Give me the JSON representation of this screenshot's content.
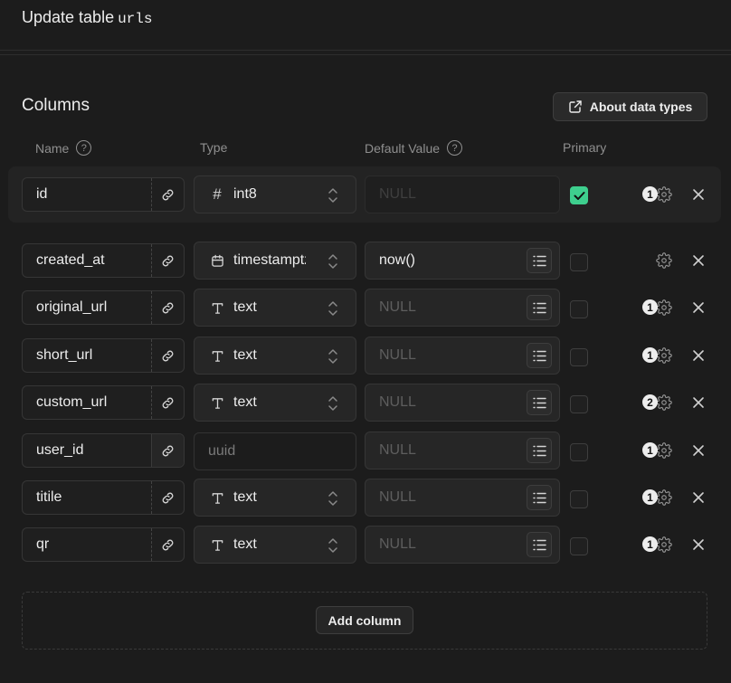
{
  "header": {
    "title_prefix": "Update table",
    "table_name": "urls"
  },
  "columns_section": {
    "title": "Columns",
    "about_button": "About data types",
    "headers": {
      "name": "Name",
      "type": "Type",
      "default_value": "Default Value",
      "primary": "Primary"
    }
  },
  "rows": [
    {
      "name": "id",
      "type": "int8",
      "type_icon": "hash-icon",
      "default": "NULL",
      "primary": true,
      "badge": "1"
    },
    {
      "name": "created_at",
      "type": "timestamptz",
      "type_icon": "calendar-icon",
      "default": "now()",
      "primary": false,
      "badge": ""
    },
    {
      "name": "original_url",
      "type": "text",
      "type_icon": "text-type-icon",
      "default": "NULL",
      "primary": false,
      "badge": "1"
    },
    {
      "name": "short_url",
      "type": "text",
      "type_icon": "text-type-icon",
      "default": "NULL",
      "primary": false,
      "badge": "1"
    },
    {
      "name": "custom_url",
      "type": "text",
      "type_icon": "text-type-icon",
      "default": "NULL",
      "primary": false,
      "badge": "2"
    },
    {
      "name": "user_id",
      "type": "uuid",
      "type_icon": "",
      "default": "NULL",
      "primary": false,
      "badge": "1"
    },
    {
      "name": "titile",
      "type": "text",
      "type_icon": "text-type-icon",
      "default": "NULL",
      "primary": false,
      "badge": "1"
    },
    {
      "name": "qr",
      "type": "text",
      "type_icon": "text-type-icon",
      "default": "NULL",
      "primary": false,
      "badge": "1"
    }
  ],
  "add_column_label": "Add column",
  "colors": {
    "background": "#1c1c1c",
    "accent_green": "#3ecf8e"
  }
}
